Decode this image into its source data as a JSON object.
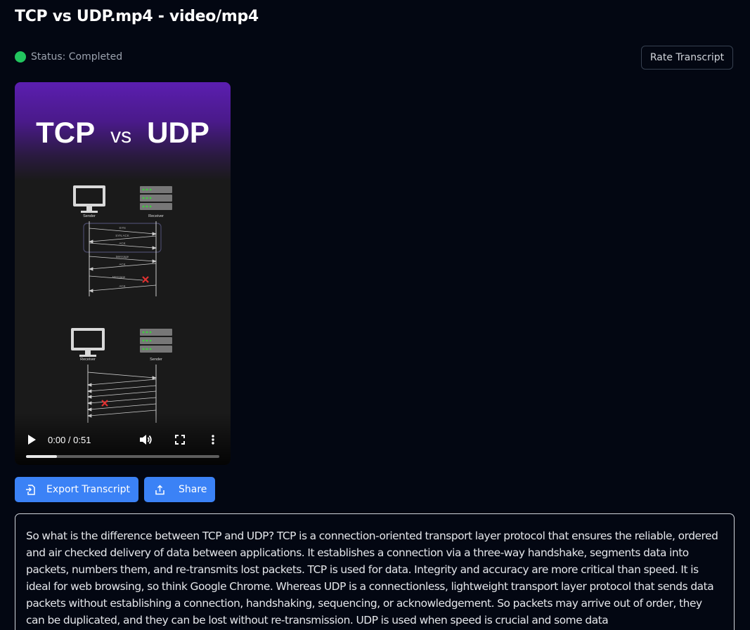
{
  "header": {
    "title": "TCP vs UDP.mp4 - video/mp4"
  },
  "status": {
    "text": "Status: Completed",
    "color": "#22c55e"
  },
  "actions": {
    "rate_label": "Rate Transcript",
    "export_label": "Export Transcript",
    "share_label": "Share"
  },
  "video": {
    "title_left": "TCP",
    "title_mid": "vs",
    "title_right": "UDP",
    "time_display": "0:00 / 0:51",
    "buffered_fraction": 0.16,
    "diagram_labels": {
      "sender": "Sender",
      "receiver": "Receiver",
      "syn": "SYN",
      "syn_ack": "SYN ACK",
      "ack": "ACK",
      "message": "Message"
    }
  },
  "transcript": {
    "text": "So what is the difference between TCP and UDP? TCP is a connection-oriented transport layer protocol that ensures the reliable, ordered and air checked delivery of data between applications. It establishes a connection via a three-way handshake, segments data into packets, numbers them, and re-transmits lost packets. TCP is used for data. Integrity and accuracy are more critical than speed. It is ideal for web browsing, so think Google Chrome. Whereas UDP is a connectionless, lightweight transport layer protocol that sends data packets without establishing a connection, handshaking, sequencing, or acknowledgement. So packets may arrive out of order, they can be duplicated, and they can be lost without re-transmission. UDP is used when speed is crucial and some data"
  },
  "colors": {
    "background": "#030712",
    "accent": "#3b82f6",
    "video_header": "#5b1eb0"
  }
}
